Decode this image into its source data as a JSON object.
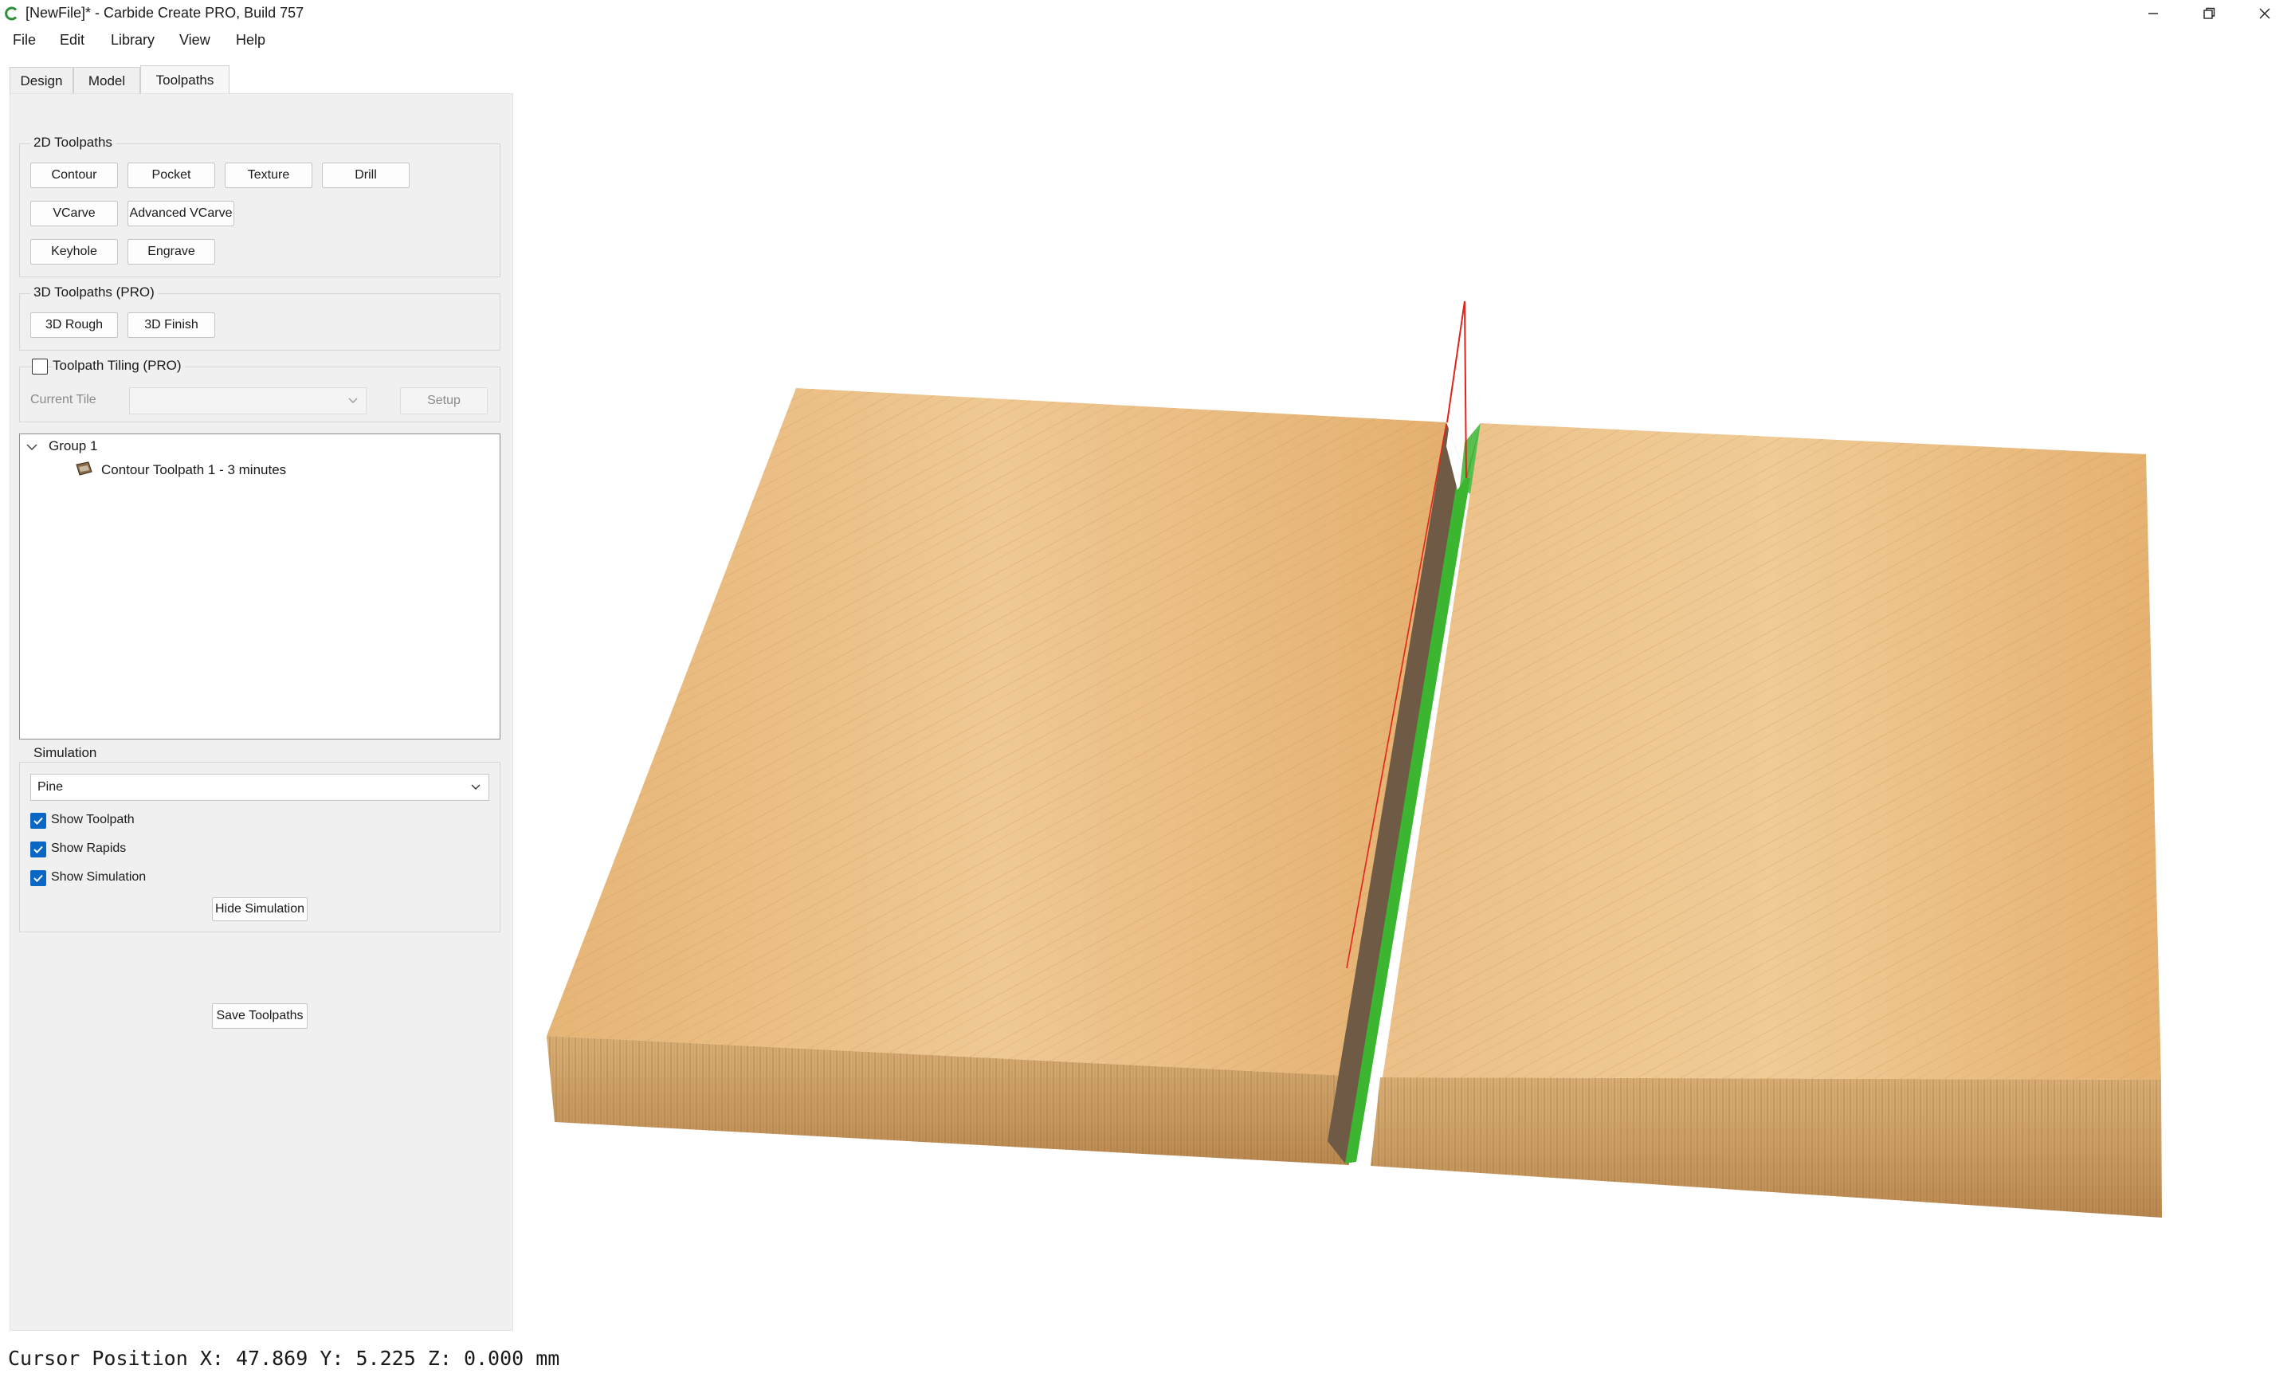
{
  "window": {
    "title": "[NewFile]* - Carbide Create PRO, Build 757",
    "controls": [
      "minimize-icon",
      "restore-icon",
      "close-icon"
    ]
  },
  "menu": {
    "items": [
      "File",
      "Edit",
      "Library",
      "View",
      "Help"
    ]
  },
  "tabs": [
    {
      "label": "Design",
      "active": false
    },
    {
      "label": "Model",
      "active": false
    },
    {
      "label": "Toolpaths",
      "active": true
    }
  ],
  "toolpaths_2d": {
    "title": "2D Toolpaths",
    "buttons": [
      "Contour",
      "Pocket",
      "Texture",
      "Drill",
      "VCarve",
      "Advanced VCarve",
      "Keyhole",
      "Engrave"
    ]
  },
  "toolpaths_3d": {
    "title": "3D Toolpaths (PRO)",
    "buttons": [
      "3D Rough",
      "3D Finish"
    ]
  },
  "tiling": {
    "label": "Toolpath Tiling (PRO)",
    "checked": false,
    "current_tile_label": "Current Tile",
    "current_tile_value": "",
    "setup_label": "Setup"
  },
  "tree": {
    "group": "Group 1",
    "items": [
      "Contour Toolpath 1 - 3 minutes"
    ]
  },
  "simulation": {
    "title": "Simulation",
    "material": "Pine",
    "show_toolpath": {
      "label": "Show Toolpath",
      "checked": true
    },
    "show_rapids": {
      "label": "Show Rapids",
      "checked": true
    },
    "show_simulation": {
      "label": "Show Simulation",
      "checked": true
    },
    "hide_button": "Hide Simulation"
  },
  "save_toolpaths": "Save Toolpaths",
  "status": {
    "cursor": "Cursor Position X: 47.869 Y: 5.225 Z: 0.000 mm"
  },
  "colors": {
    "wood_light": "#edc48b",
    "wood_mid": "#dca86a",
    "groove_wall": "#6e5a45",
    "toolpath_green": "#3cb530",
    "rapid_red": "#e0241c",
    "checkbox_blue": "#0a67c4"
  }
}
